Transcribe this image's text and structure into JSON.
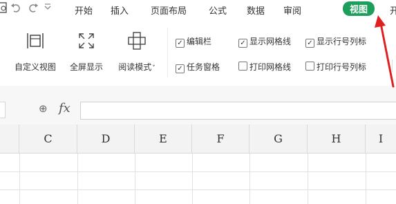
{
  "menu": {
    "tabs": [
      "开始",
      "插入",
      "页面布局",
      "公式",
      "数据",
      "审阅",
      "视图",
      "开"
    ],
    "active_tab": "视图"
  },
  "quick_access": [
    "print-preview-icon",
    "undo-icon",
    "redo-icon",
    "customize-dropdown-icon"
  ],
  "ribbon": {
    "custom_view": "自定义视图",
    "fullscreen": "全屏显示",
    "reading_mode": "阅读模式",
    "reading_mode_arrow": "˅",
    "checkboxes": [
      {
        "label": "编辑栏",
        "checked": true
      },
      {
        "label": "显示网格线",
        "checked": true
      },
      {
        "label": "显示行号列标",
        "checked": true
      },
      {
        "label": "任务窗格",
        "checked": true
      },
      {
        "label": "打印网格线",
        "checked": false
      },
      {
        "label": "打印行号列标",
        "checked": false
      }
    ],
    "check_mark": "✓"
  },
  "formula_bar": {
    "zoom_icon": "⊕",
    "fx_label": "fx",
    "value": ""
  },
  "grid": {
    "columns": [
      "C",
      "D",
      "E",
      "F",
      "G",
      "H",
      "I"
    ]
  },
  "colors": {
    "active_tab_bg": "#1e9e5c",
    "annotation_arrow": "#e02020"
  }
}
